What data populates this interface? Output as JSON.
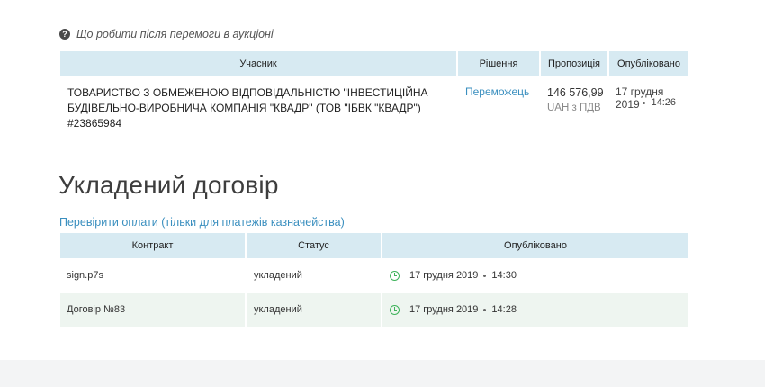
{
  "help": {
    "text": "Що робити після перемоги в аукціоні",
    "icon": "question-circle-icon"
  },
  "winners_table": {
    "headers": {
      "participant": "Учасник",
      "decision": "Рішення",
      "offer": "Пропозиція",
      "published": "Опубліковано"
    },
    "rows": [
      {
        "participant": "ТОВАРИСТВО З ОБМЕЖЕНОЮ ВІДПОВІДАЛЬНІСТЮ \"ІНВЕСТИЦІЙНА БУДІВЕЛЬНО-ВИРОБНИЧА КОМПАНІЯ \"КВАДР\" (ТОВ \"ІБВК \"КВАДР\") #23865984",
        "decision": "Переможець",
        "offer_amount": "146 576,99",
        "offer_currency": "UAH з ПДВ",
        "published_date": "17 грудня 2019",
        "published_time": "14:26"
      }
    ]
  },
  "contract_section": {
    "title": "Укладений договір",
    "check_payments_link": "Перевірити оплати (тільки для платежів казначейства)"
  },
  "contracts_table": {
    "headers": {
      "contract": "Контракт",
      "status": "Статус",
      "published": "Опубліковано"
    },
    "rows": [
      {
        "contract": "sign.p7s",
        "status": "укладений",
        "date": "17 грудня 2019",
        "time": "14:30"
      },
      {
        "contract": "Договір №83",
        "status": "укладений",
        "date": "17 грудня 2019",
        "time": "14:28"
      }
    ]
  },
  "colors": {
    "accent_link": "#3a8fbf",
    "header_bg": "#d7eaf2",
    "clock_green": "#3fb35b",
    "row_shade": "#eef5f0"
  }
}
